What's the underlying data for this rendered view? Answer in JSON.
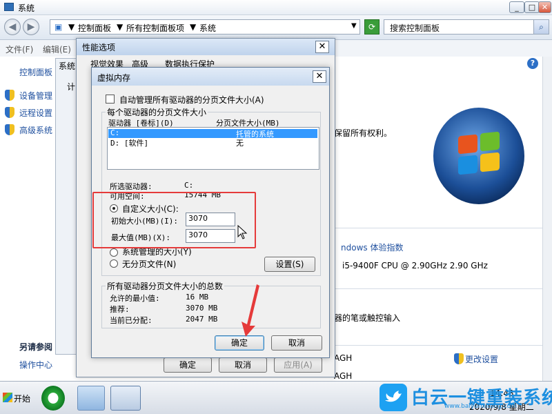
{
  "window": {
    "title": "系统",
    "btn_min": "_",
    "btn_max": "□",
    "btn_close": "✕"
  },
  "address": {
    "crumb1": "控制面板",
    "crumb2": "所有控制面板项",
    "crumb3": "系统",
    "search_placeholder": "搜索控制面板"
  },
  "menu": {
    "file": "文件(F)",
    "edit": "编辑(E)"
  },
  "left": {
    "home": "控制面板",
    "device_manager": "设备管理",
    "remote": "远程设置",
    "advanced": "高级系统",
    "see_also": "另请参阅",
    "action_center": "操作中心"
  },
  "right": {
    "copyright": "保留所有权利。",
    "wei": "ndows 体验指数",
    "cpu": "i5-9400F CPU @ 2.90GHz   2.90 GHz",
    "pen": "器的笔或触控输入",
    "agh1": "AGH",
    "agh2": "AGH",
    "change": "更改设置"
  },
  "perf": {
    "title": "性能选项",
    "tab1": "视觉效果",
    "tab2": "高级",
    "tab3": "数据执行保护",
    "sys_tab": "系统",
    "left_frag": "计",
    "ok": "确定",
    "cancel": "取消",
    "apply": "应用(A)"
  },
  "vm": {
    "title": "虚拟内存",
    "auto_manage": "自动管理所有驱动器的分页文件大小(A)",
    "group_each": "每个驱动器的分页文件大小",
    "col_drive": "驱动器 [卷标](D)",
    "col_size": "分页文件大小(MB)",
    "drives": [
      {
        "drive": "C:",
        "size": "托管的系统"
      },
      {
        "drive": "D:   [软件]",
        "size": "无"
      }
    ],
    "selected_drive_label": "所选驱动器:",
    "selected_drive_value": "C:",
    "free_label": "可用空间:",
    "free_value": "15744 MB",
    "custom_size": "自定义大小(C):",
    "initial_label": "初始大小(MB)(I):",
    "initial_value": "3070",
    "max_label": "最大值(MB)(X):",
    "max_value": "3070",
    "system_managed": "系统管理的大小(Y)",
    "no_paging": "无分页文件(N)",
    "set_button": "设置(S)",
    "group_total": "所有驱动器分页文件大小的总数",
    "min_allowed_label": "允许的最小值:",
    "min_allowed_value": "16 MB",
    "recommended_label": "推荐:",
    "recommended_value": "3070 MB",
    "allocated_label": "当前已分配:",
    "allocated_value": "2047 MB",
    "ok": "确定",
    "cancel": "取消"
  },
  "taskbar": {
    "start": "开始",
    "time": "14:43",
    "date": "2020/9/8 星期二"
  },
  "watermark": {
    "text": "白云一键重装系统",
    "url": "www.baiyunxitong.com"
  },
  "colors": {
    "highlight": "#3399ff",
    "annotation_red": "#e53a3a",
    "link_blue": "#1e4f9e"
  }
}
